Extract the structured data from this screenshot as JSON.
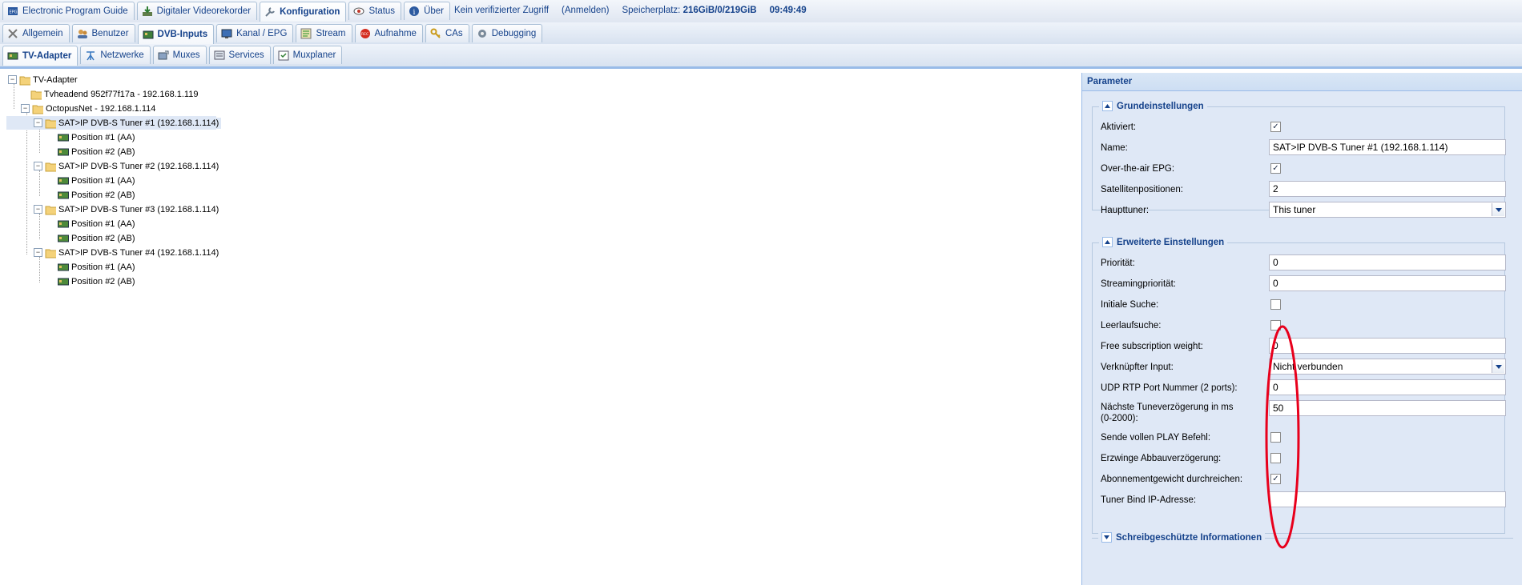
{
  "top_tabs": [
    {
      "label": "Electronic Program Guide",
      "icon": "epg-icon",
      "active": false
    },
    {
      "label": "Digitaler Videorekorder",
      "icon": "download-recorder-icon",
      "active": false
    },
    {
      "label": "Konfiguration",
      "icon": "wrench-icon",
      "active": true
    },
    {
      "label": "Status",
      "icon": "eye-icon",
      "active": false
    },
    {
      "label": "Über",
      "icon": "info-icon",
      "active": false
    }
  ],
  "status": {
    "access": "Kein verifizierter Zugriff",
    "login": "(Anmelden)",
    "storage_label": "Speicherplatz:",
    "storage_value": "216GiB/0/219GiB",
    "clock": "09:49:49"
  },
  "second_tabs": [
    {
      "label": "Allgemein",
      "icon": "tools-icon"
    },
    {
      "label": "Benutzer",
      "icon": "users-icon"
    },
    {
      "label": "DVB-Inputs",
      "icon": "card-icon",
      "active": true
    },
    {
      "label": "Kanal / EPG",
      "icon": "tv-icon"
    },
    {
      "label": "Stream",
      "icon": "stream-icon"
    },
    {
      "label": "Aufnahme",
      "icon": "rec-icon"
    },
    {
      "label": "CAs",
      "icon": "key-icon"
    },
    {
      "label": "Debugging",
      "icon": "bug-icon"
    }
  ],
  "third_tabs": [
    {
      "label": "TV-Adapter",
      "icon": "adapter-icon",
      "active": true
    },
    {
      "label": "Netzwerke",
      "icon": "antenna-icon"
    },
    {
      "label": "Muxes",
      "icon": "mux-icon"
    },
    {
      "label": "Services",
      "icon": "services-icon"
    },
    {
      "label": "Muxplaner",
      "icon": "planner-icon"
    }
  ],
  "tree": {
    "root": "TV-Adapter",
    "host1": "Tvheadend 952f77f17a - 192.168.1.119",
    "host2": "OctopusNet - 192.168.1.114",
    "tuners": [
      {
        "label": "SAT>IP DVB-S Tuner #1 (192.168.1.114)",
        "positions": [
          "Position #1 (AA)",
          "Position #2 (AB)"
        ]
      },
      {
        "label": "SAT>IP DVB-S Tuner #2 (192.168.1.114)",
        "positions": [
          "Position #1 (AA)",
          "Position #2 (AB)"
        ]
      },
      {
        "label": "SAT>IP DVB-S Tuner #3 (192.168.1.114)",
        "positions": [
          "Position #1 (AA)",
          "Position #2 (AB)"
        ]
      },
      {
        "label": "SAT>IP DVB-S Tuner #4 (192.168.1.114)",
        "positions": [
          "Position #1 (AA)",
          "Position #2 (AB)"
        ]
      }
    ]
  },
  "panel": {
    "title": "Parameter",
    "basic": {
      "legend": "Grundeinstellungen",
      "aktiviert": {
        "label": "Aktiviert:",
        "checked": true
      },
      "name": {
        "label": "Name:",
        "value": "SAT>IP DVB-S Tuner #1 (192.168.1.114)"
      },
      "epg": {
        "label": "Over-the-air EPG:",
        "checked": true
      },
      "satpos": {
        "label": "Satellitenpositionen:",
        "value": "2"
      },
      "haupttuner": {
        "label": "Haupttuner:",
        "value": "This tuner"
      }
    },
    "advanced": {
      "legend": "Erweiterte Einstellungen",
      "prioritaet": {
        "label": "Priorität:",
        "value": "0"
      },
      "streamprio": {
        "label": "Streamingpriorität:",
        "value": "0"
      },
      "initiale": {
        "label": "Initiale Suche:",
        "checked": false
      },
      "leerlauf": {
        "label": "Leerlaufsuche:",
        "checked": false
      },
      "freesub": {
        "label": "Free subscription weight:",
        "value": "0"
      },
      "linked": {
        "label": "Verknüpfter Input:",
        "value": "Nicht verbunden"
      },
      "udp": {
        "label": "UDP RTP Port Nummer (2 ports):",
        "value": "0"
      },
      "tunedelay": {
        "label": "Nächste Tuneverzögerung in ms",
        "label2": "(0-2000):",
        "value": "50"
      },
      "play": {
        "label": "Sende vollen PLAY Befehl:",
        "checked": false
      },
      "abbau": {
        "label": "Erzwinge Abbauverzögerung:",
        "checked": false
      },
      "abo": {
        "label": "Abonnementgewicht durchreichen:",
        "checked": true
      },
      "bindip": {
        "label": "Tuner Bind IP-Adresse:",
        "value": ""
      }
    },
    "readonly": {
      "legend": "Schreibgeschützte Informationen"
    }
  },
  "check_glyph": "✓",
  "annotation_color": "#e8001c"
}
